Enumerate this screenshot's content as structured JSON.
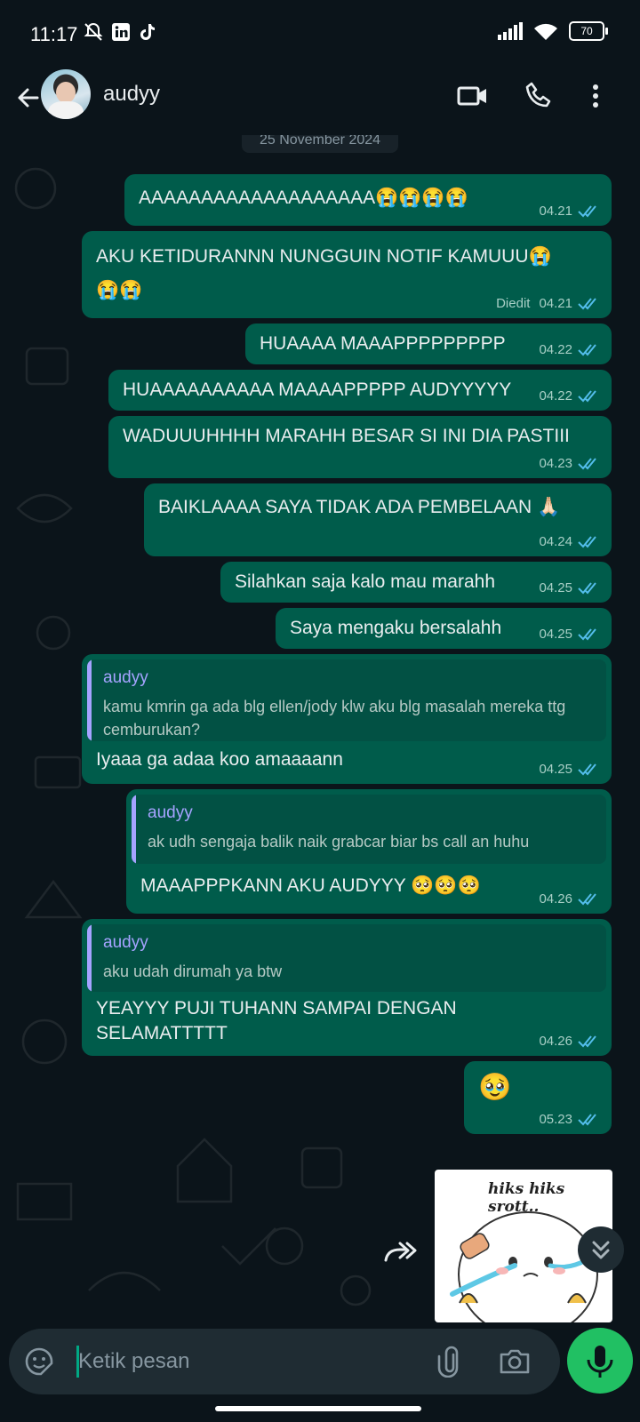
{
  "status": {
    "time": "11:17",
    "battery": "70"
  },
  "header": {
    "contact_name": "audyy"
  },
  "chat": {
    "date_separator": "25 November 2024",
    "messages": [
      {
        "text": "AAAAAAAAAAAAAAAAAAA😭😭😭😭",
        "time": "04.21"
      },
      {
        "line1": "AKU KETIDURANNN NUNGGUIN NOTIF KAMUUU😭",
        "line2": "😭😭",
        "edited": "Diedit",
        "time": "04.21"
      },
      {
        "text": "HUAAAA MAAAPPPPPPPPP",
        "time": "04.22"
      },
      {
        "text": "HUAAAAAAAAAA MAAAAPPPPP AUDYYYYY",
        "time": "04.22"
      },
      {
        "text": "WADUUUHHHH MARAHH BESAR SI INI DIA PASTIII",
        "time": "04.23"
      },
      {
        "text": "BAIKLAAAA SAYA TIDAK ADA PEMBELAAN 🙏🏻",
        "time": "04.24"
      },
      {
        "text": "Silahkan saja kalo mau marahh",
        "time": "04.25"
      },
      {
        "text": "Saya mengaku bersalahh",
        "time": "04.25"
      },
      {
        "quote_name": "audyy",
        "quote_text": "kamu kmrin ga ada blg ellen/jody klw aku blg masalah mereka ttg cemburukan?",
        "text": "Iyaaa ga adaa koo amaaaann",
        "time": "04.25"
      },
      {
        "quote_name": "audyy",
        "quote_text": "ak udh sengaja balik naik grabcar biar bs call an huhu",
        "text": "MAAAPPPKANN AKU AUDYYY 🥺🥺🥺",
        "time": "04.26"
      },
      {
        "quote_name": "audyy",
        "quote_text": "aku udah dirumah ya btw",
        "line1": "YEAYYY PUJI TUHANN SAMPAI DENGAN",
        "line2": "SELAMATTTTT",
        "time": "04.26"
      },
      {
        "text": "🥹",
        "time": "05.23"
      }
    ],
    "sticker_caption": "hiks hiks srott.."
  },
  "composer": {
    "placeholder": "Ketik pesan"
  },
  "colors": {
    "outgoing_bubble": "#005c4b",
    "accent": "#21c063",
    "tick_read": "#53bdeb",
    "background": "#0b141a"
  }
}
